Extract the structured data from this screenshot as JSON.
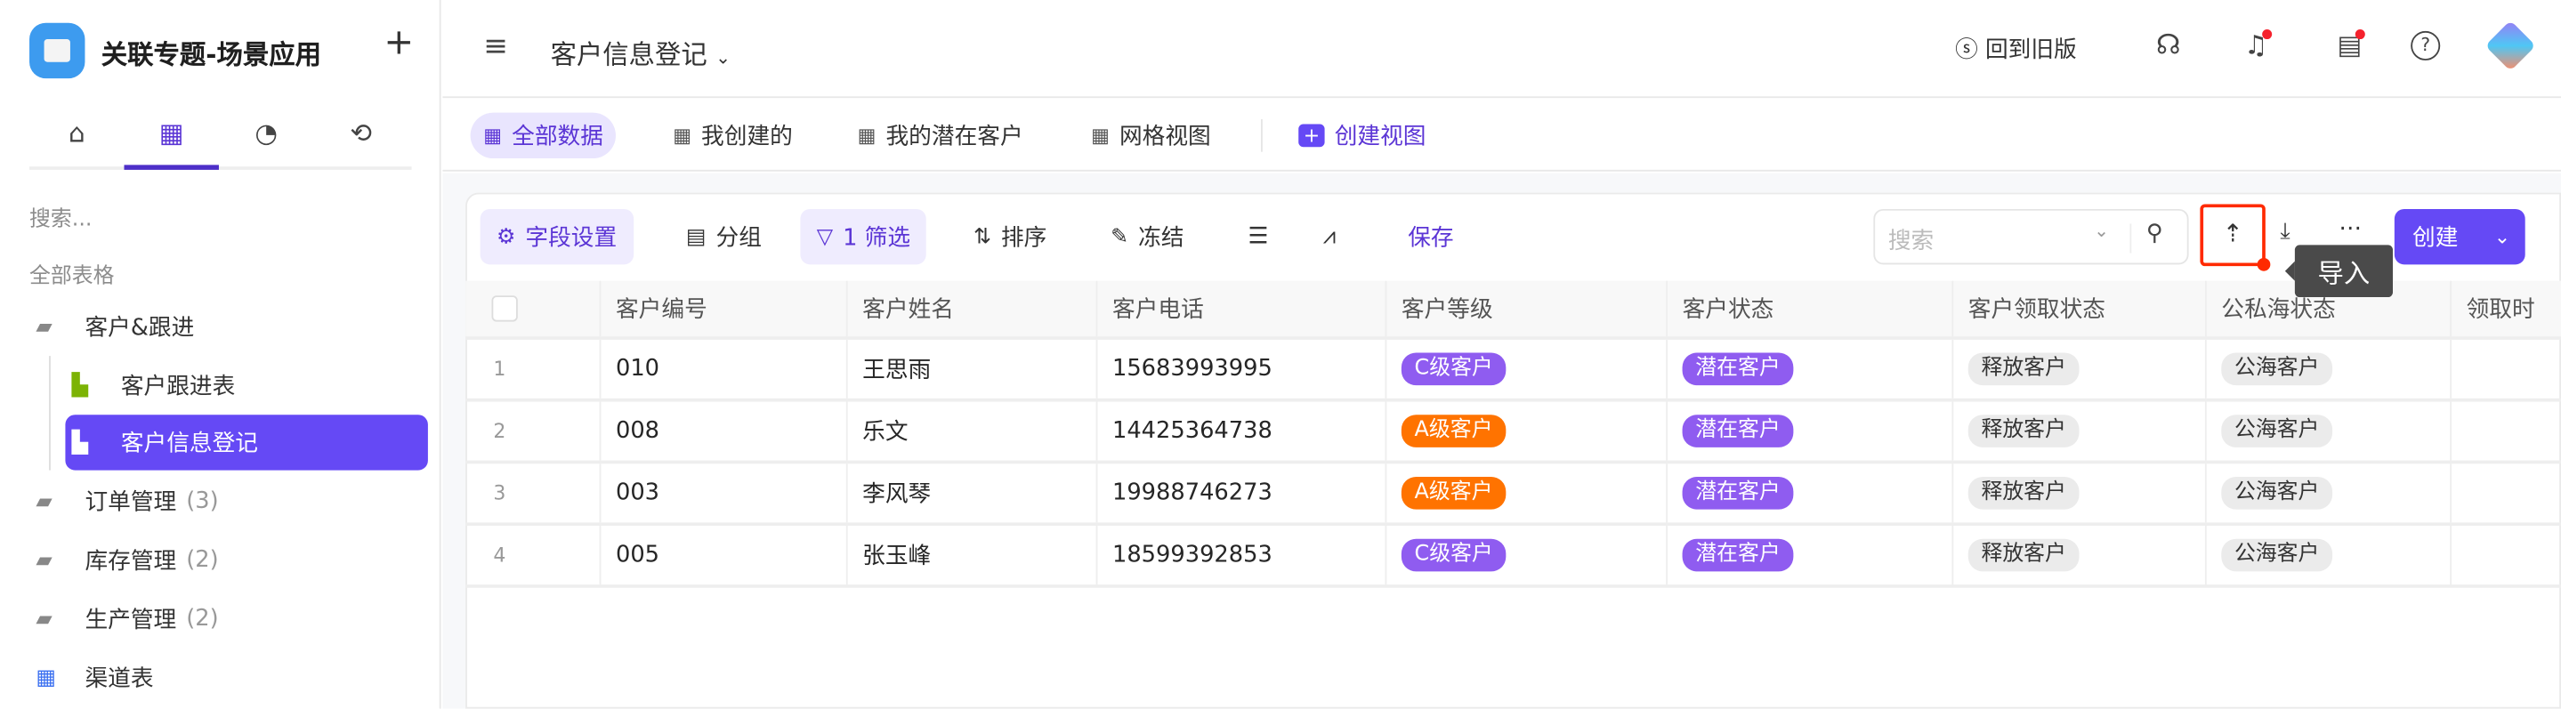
{
  "app": {
    "title": "关联专题-场景应用",
    "add_icon": "plus-icon"
  },
  "sidebar": {
    "tabs": [
      {
        "icon": "home-icon",
        "glyph": "⌂"
      },
      {
        "icon": "table-icon",
        "glyph": "▦"
      },
      {
        "icon": "chart-icon",
        "glyph": "◔"
      },
      {
        "icon": "workflow-icon",
        "glyph": "⟲"
      }
    ],
    "search_placeholder": "搜索...",
    "section": "全部表格",
    "items": [
      {
        "label": "客户&跟进",
        "count": ""
      },
      {
        "label": "客户跟进表",
        "count": ""
      },
      {
        "label": "客户信息登记",
        "count": ""
      },
      {
        "label": "订单管理",
        "count": "(3)"
      },
      {
        "label": "库存管理",
        "count": "(2)"
      },
      {
        "label": "生产管理",
        "count": "(2)"
      },
      {
        "label": "渠道表",
        "count": ""
      }
    ]
  },
  "header": {
    "title": "客户信息登记",
    "old_version": "回到旧版"
  },
  "views": [
    "全部数据",
    "我创建的",
    "我的潜在客户",
    "网格视图",
    "创建视图"
  ],
  "toolbar": {
    "field_settings": "字段设置",
    "group": "分组",
    "filter": "1 筛选",
    "sort": "排序",
    "freeze": "冻结",
    "save": "保存",
    "search_placeholder": "搜索",
    "create": "创建",
    "tooltip": "导入"
  },
  "colors": {
    "accent": "#6549f5",
    "tag_c": "#8f5cf0",
    "tag_a": "#ff7300",
    "tag_potential": "#8f5cf0",
    "highlight": "#ff2a00"
  },
  "table": {
    "columns": [
      "客户编号",
      "客户姓名",
      "客户电话",
      "客户等级",
      "客户状态",
      "客户领取状态",
      "公私海状态",
      "领取时"
    ],
    "rows": [
      {
        "n": "1",
        "id": "010",
        "name": "王思雨",
        "phone": "15683993995",
        "level": "C级客户",
        "status": "潜在客户",
        "claim": "释放客户",
        "sea": "公海客户"
      },
      {
        "n": "2",
        "id": "008",
        "name": "乐文",
        "phone": "14425364738",
        "level": "A级客户",
        "status": "潜在客户",
        "claim": "释放客户",
        "sea": "公海客户"
      },
      {
        "n": "3",
        "id": "003",
        "name": "李风琴",
        "phone": "19988746273",
        "level": "A级客户",
        "status": "潜在客户",
        "claim": "释放客户",
        "sea": "公海客户"
      },
      {
        "n": "4",
        "id": "005",
        "name": "张玉峰",
        "phone": "18599392853",
        "level": "C级客户",
        "status": "潜在客户",
        "claim": "释放客户",
        "sea": "公海客户"
      }
    ]
  }
}
